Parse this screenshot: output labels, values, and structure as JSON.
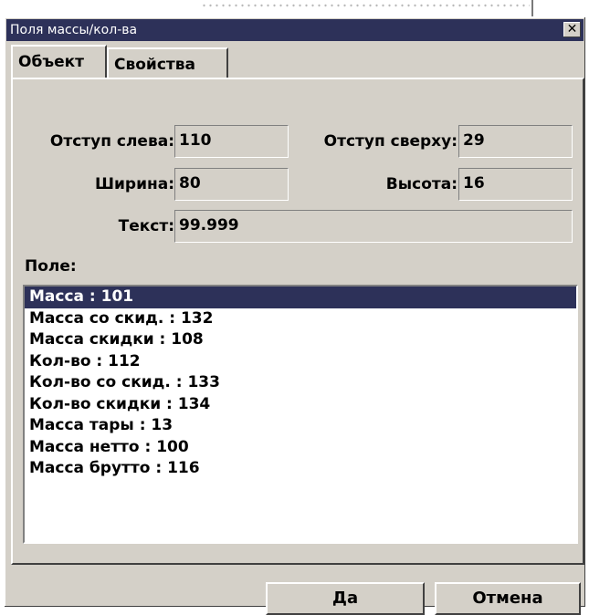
{
  "window": {
    "title": "Поля массы/кол-ва",
    "close_symbol": "✕"
  },
  "tabs": [
    {
      "label": "Объект",
      "active": true
    },
    {
      "label": "Свойства",
      "active": false
    }
  ],
  "fields": {
    "left_offset": {
      "label": "Отступ слева:",
      "value": "110"
    },
    "top_offset": {
      "label": "Отступ сверху:",
      "value": "29"
    },
    "width": {
      "label": "Ширина:",
      "value": "80"
    },
    "height": {
      "label": "Высота:",
      "value": "16"
    },
    "text": {
      "label": "Текст:",
      "value": "99.999"
    }
  },
  "field_list": {
    "label": "Поле:",
    "items": [
      "Масса : 101",
      "Масса со скид. : 132",
      "Масса скидки : 108",
      "Кол-во : 112",
      "Кол-во со скид. : 133",
      "Кол-во скидки : 134",
      "Масса тары : 13",
      "Масса нетто : 100",
      "Масса брутто : 116"
    ],
    "selected_index": 0
  },
  "buttons": {
    "ok": "Да",
    "cancel": "Отмена"
  },
  "colors": {
    "face": "#d4d0c8",
    "titlebar": "#2d3159",
    "selection": "#2d3159"
  }
}
